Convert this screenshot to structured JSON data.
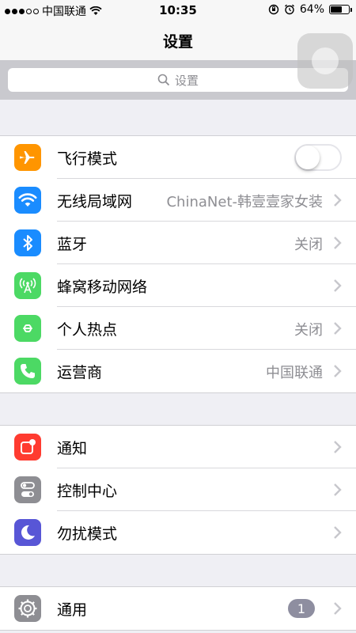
{
  "status_bar": {
    "carrier": "中国联通",
    "time": "10:35",
    "battery_percent": "64%",
    "battery_level": 0.64,
    "signal_dots_filled": 3,
    "signal_dots_total": 5
  },
  "nav": {
    "title": "设置"
  },
  "search": {
    "placeholder": "设置"
  },
  "groups": [
    {
      "rows": [
        {
          "id": "airplane",
          "label": "飞行模式",
          "icon": "airplane-icon",
          "color": "#ff9500",
          "toggle": true,
          "toggle_on": false
        },
        {
          "id": "wifi",
          "label": "无线局域网",
          "icon": "wifi-icon",
          "color": "#1a8cff",
          "value": "ChinaNet-韩壹壹家女装"
        },
        {
          "id": "bluetooth",
          "label": "蓝牙",
          "icon": "bluetooth-icon",
          "color": "#1a8cff",
          "value": "关闭"
        },
        {
          "id": "cellular",
          "label": "蜂窝移动网络",
          "icon": "cellular-icon",
          "color": "#4cd964",
          "value": ""
        },
        {
          "id": "hotspot",
          "label": "个人热点",
          "icon": "hotspot-icon",
          "color": "#4cd964",
          "value": "关闭"
        },
        {
          "id": "carrier",
          "label": "运营商",
          "icon": "phone-icon",
          "color": "#4cd964",
          "value": "中国联通"
        }
      ]
    },
    {
      "rows": [
        {
          "id": "notifications",
          "label": "通知",
          "icon": "notifications-icon",
          "color": "#ff3b30"
        },
        {
          "id": "control-center",
          "label": "控制中心",
          "icon": "control-center-icon",
          "color": "#8e8e93"
        },
        {
          "id": "do-not-disturb",
          "label": "勿扰模式",
          "icon": "moon-icon",
          "color": "#5856d6"
        }
      ]
    },
    {
      "rows": [
        {
          "id": "general",
          "label": "通用",
          "icon": "gear-icon",
          "color": "#8e8e93",
          "badge": "1"
        }
      ]
    }
  ]
}
